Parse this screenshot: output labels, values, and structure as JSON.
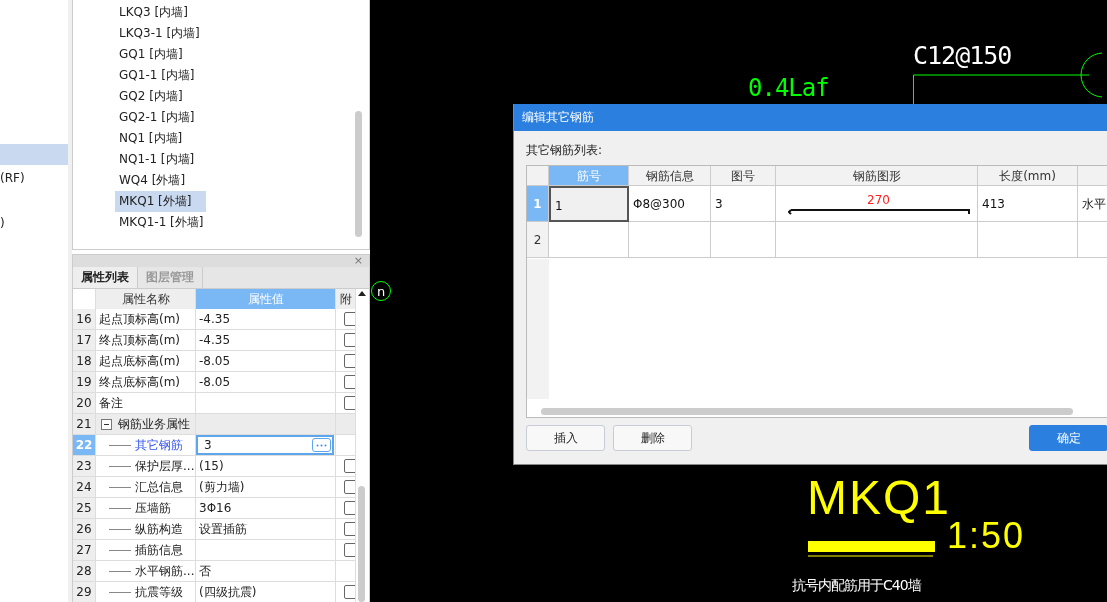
{
  "left_panel": {
    "items": [
      {
        "selected": true
      },
      {
        "label": "(RF)",
        "selected": false
      },
      {
        "label": ")",
        "selected": false
      }
    ]
  },
  "component_list": {
    "items": [
      {
        "label": "LKQ3 [内墙]",
        "selected": false
      },
      {
        "label": "LKQ3-1 [内墙]",
        "selected": false
      },
      {
        "label": "GQ1 [内墙]",
        "selected": false
      },
      {
        "label": "GQ1-1 [内墙]",
        "selected": false
      },
      {
        "label": "GQ2 [内墙]",
        "selected": false
      },
      {
        "label": "GQ2-1 [内墙]",
        "selected": false
      },
      {
        "label": "NQ1 [内墙]",
        "selected": false
      },
      {
        "label": "NQ1-1 [内墙]",
        "selected": false
      },
      {
        "label": "WQ4 [外墙]",
        "selected": false
      },
      {
        "label": "MKQ1 [外墙]",
        "selected": true
      },
      {
        "label": "MKQ1-1 [外墙]",
        "selected": false
      }
    ]
  },
  "properties": {
    "close": "×",
    "tabs": [
      {
        "label": "属性列表",
        "selected": true
      },
      {
        "label": "图层管理",
        "selected": false
      }
    ],
    "columns": [
      {
        "label": "属性名称",
        "selected": false
      },
      {
        "label": "属性值",
        "selected": true
      },
      {
        "label": "附",
        "selected": false
      }
    ],
    "rows": [
      {
        "num": "16",
        "kind": "plain",
        "name": "起点顶标高(m)",
        "value": "-4.35",
        "checked": false,
        "selected": false
      },
      {
        "num": "17",
        "kind": "plain",
        "name": "终点顶标高(m)",
        "value": "-4.35",
        "checked": false,
        "selected": false
      },
      {
        "num": "18",
        "kind": "plain",
        "name": "起点底标高(m)",
        "value": "-8.05",
        "checked": false,
        "selected": false
      },
      {
        "num": "19",
        "kind": "plain",
        "name": "终点底标高(m)",
        "value": "-8.05",
        "checked": false,
        "selected": false
      },
      {
        "num": "20",
        "kind": "plain",
        "name": "备注",
        "checked": false,
        "selected": false
      },
      {
        "num": "21",
        "kind": "group",
        "name": "钢筋业务属性",
        "expanded": true,
        "selected": false
      },
      {
        "num": "22",
        "kind": "child",
        "name": "其它钢筋",
        "value": "3",
        "selected": true
      },
      {
        "num": "23",
        "kind": "child",
        "name": "保护层厚...",
        "value": "(15)",
        "checked": false,
        "selected": false
      },
      {
        "num": "24",
        "kind": "child",
        "name": "汇总信息",
        "value": "(剪力墙)",
        "checked": false,
        "selected": false
      },
      {
        "num": "25",
        "kind": "child",
        "name": "压墙筋",
        "value": "3Φ16",
        "checked": false,
        "selected": false
      },
      {
        "num": "26",
        "kind": "child",
        "name": "纵筋构造",
        "value": "设置插筋",
        "checked": false,
        "selected": false
      },
      {
        "num": "27",
        "kind": "child",
        "name": "插筋信息",
        "checked": false,
        "selected": false
      },
      {
        "num": "28",
        "kind": "child",
        "name": "水平钢筋...",
        "value": "否",
        "selected": false
      },
      {
        "num": "29",
        "kind": "child",
        "name": "抗震等级",
        "value": "(四级抗震)",
        "checked": false,
        "selected": false
      }
    ]
  },
  "drawing": {
    "texts": [
      {
        "kind": "label",
        "text": "0.4Laf",
        "color": "#00ff00"
      },
      {
        "kind": "label",
        "text": "C12@150",
        "color": "#ffffff"
      },
      {
        "kind": "marker",
        "text": "n",
        "color": "#00ff00"
      },
      {
        "kind": "title",
        "text": "MKQ1",
        "color": "#ffff00"
      },
      {
        "kind": "scale",
        "text": "1:50",
        "color": "#ffff00"
      },
      {
        "kind": "note",
        "text": "抗号内配筋用于C40墙",
        "color": "#ffffff"
      }
    ]
  },
  "dialog": {
    "title": "编辑其它钢筋",
    "list_label": "其它钢筋列表:",
    "columns": [
      {
        "label": "筋号",
        "selected": true
      },
      {
        "label": "钢筋信息",
        "selected": false
      },
      {
        "label": "图号",
        "selected": false
      },
      {
        "label": "钢筋图形",
        "selected": false
      },
      {
        "label": "长度(mm)",
        "selected": false
      },
      {
        "selected": false
      }
    ],
    "rows": [
      {
        "num": "1",
        "selected": true,
        "cells": [
          {
            "kind": "text",
            "text": "1"
          },
          {
            "kind": "text",
            "text": "Φ8@300"
          },
          {
            "kind": "text",
            "text": "3"
          },
          {
            "kind": "shape",
            "text": "270"
          },
          {
            "kind": "text",
            "text": "413"
          },
          {
            "kind": "text",
            "text": "水平"
          }
        ]
      },
      {
        "num": "2",
        "selected": false
      }
    ],
    "buttons": [
      {
        "label": "插入",
        "kind": "normal"
      },
      {
        "label": "删除",
        "kind": "normal"
      },
      {
        "label": "确定",
        "kind": "primary"
      }
    ]
  }
}
